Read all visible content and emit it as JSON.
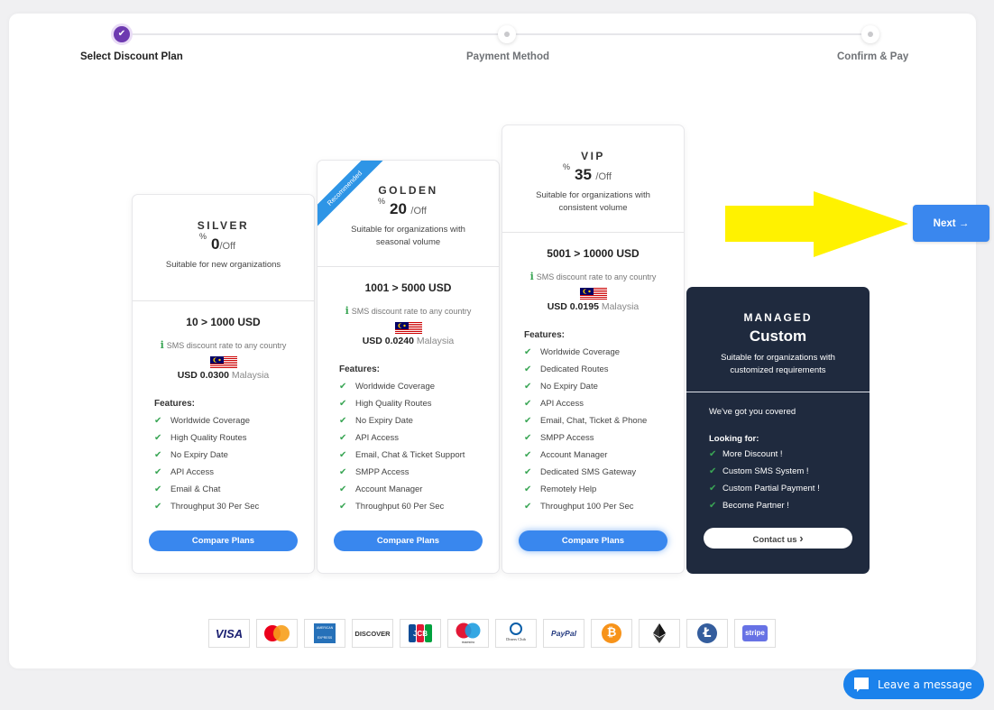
{
  "stepper": {
    "steps": [
      {
        "label": "Select Discount Plan",
        "state": "completed"
      },
      {
        "label": "Payment Method",
        "state": "pending"
      },
      {
        "label": "Confirm & Pay",
        "state": "pending"
      }
    ],
    "check_glyph": "✔"
  },
  "plans": [
    {
      "name": "SILVER",
      "percent_symbol": "%",
      "discount": "0",
      "off_label": "/Off",
      "description": "Suitable for new organizations",
      "range": "10 > 1000 USD",
      "sms_note": "SMS discount rate to any country",
      "rate_value": "USD 0.0300",
      "rate_country": "Malaysia",
      "features_title": "Features:",
      "features": [
        "Worldwide Coverage",
        "High Quality Routes",
        "No Expiry Date",
        "API Access",
        "Email & Chat",
        "Throughput 30 Per Sec"
      ],
      "button_label": "Compare Plans"
    },
    {
      "name": "GOLDEN",
      "ribbon": "Recommended",
      "percent_symbol": "%",
      "discount": "20",
      "off_label": "/Off",
      "description": "Suitable for organizations with seasonal volume",
      "range": "1001 > 5000 USD",
      "sms_note": "SMS discount rate to any country",
      "rate_value": "USD 0.0240",
      "rate_country": "Malaysia",
      "features_title": "Features:",
      "features": [
        "Worldwide Coverage",
        "High Quality Routes",
        "No Expiry Date",
        "API Access",
        "Email, Chat & Ticket Support",
        "SMPP Access",
        "Account Manager",
        "Throughput 60 Per Sec"
      ],
      "button_label": "Compare Plans"
    },
    {
      "name": "VIP",
      "percent_symbol": "%",
      "discount": "35",
      "off_label": "/Off",
      "description": "Suitable for organizations with consistent volume",
      "range": "5001 > 10000 USD",
      "sms_note": "SMS discount rate to any country",
      "rate_value": "USD 0.0195",
      "rate_country": "Malaysia",
      "features_title": "Features:",
      "features": [
        "Worldwide Coverage",
        "Dedicated Routes",
        "No Expiry Date",
        "API Access",
        "Email, Chat, Ticket & Phone",
        "SMPP Access",
        "Account Manager",
        "Dedicated SMS Gateway",
        "Remotely Help",
        "Throughput 100 Per Sec"
      ],
      "button_label": "Compare Plans"
    }
  ],
  "managed": {
    "name": "MANAGED",
    "title": "Custom",
    "description": "Suitable for organizations with customized requirements",
    "covered": "We've got you covered",
    "looking_title": "Looking for:",
    "items": [
      "More Discount !",
      "Custom SMS System !",
      "Custom Partial Payment !",
      "Become Partner !"
    ],
    "button_label": "Contact us",
    "button_icon": "›"
  },
  "next_button": {
    "label": "Next",
    "icon": "→"
  },
  "info_glyph": "i",
  "check_glyph": "✔",
  "payment_methods": [
    "visa",
    "mastercard",
    "american-express",
    "discover",
    "jcb",
    "maestro",
    "diners-club",
    "paypal",
    "bitcoin",
    "ethereum",
    "litecoin",
    "stripe"
  ],
  "payment_texts": {
    "visa": "VISA",
    "discover": "DISCOVER",
    "jcb": "JCB",
    "paypal": "PayPal",
    "stripe": "stripe",
    "bitcoin": "₿",
    "litecoin": "Ł",
    "maestro": "maestro",
    "diners": "Diners Club",
    "amex": "AMERICAN EXPRESS"
  },
  "chat": {
    "label": "Leave a message"
  },
  "colors": {
    "accent": "#3a87ee",
    "stepper_active": "#6d3ab0",
    "check": "#3aa655",
    "managed_bg": "#1f2a3e",
    "highlight_arrow": "#fff200",
    "ribbon": "#2e95e6"
  }
}
